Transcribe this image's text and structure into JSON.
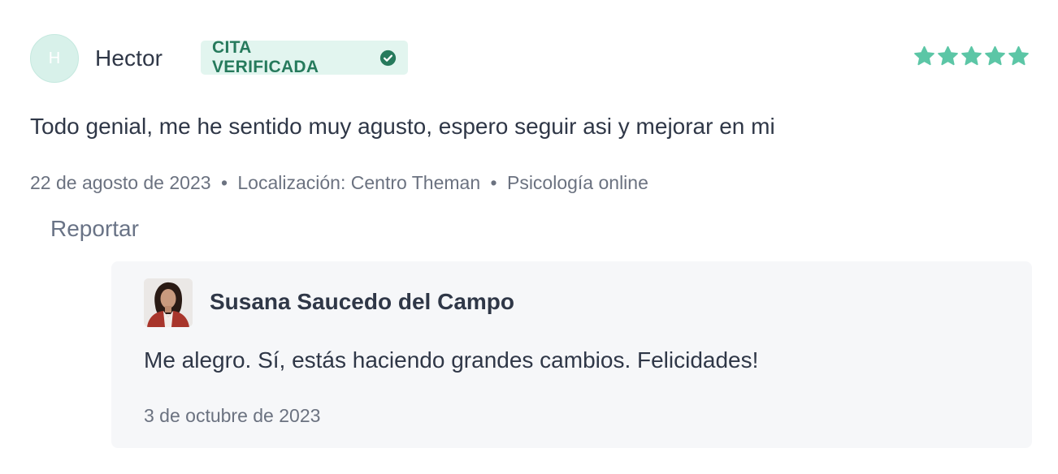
{
  "review": {
    "avatar_initial": "H",
    "author": "Hector",
    "badge_label": "CITA VERIFICADA",
    "badge_icon": "check-circle-icon",
    "rating": 5,
    "rating_max": 5,
    "star_color": "#5cc6a6",
    "text": "Todo genial, me he sentido muy agusto, espero seguir asi y mejorar en mi",
    "date": "22 de agosto de 2023",
    "location": "Localización: Centro Theman",
    "service": "Psicología online",
    "separator": "•",
    "report_label": "Reportar"
  },
  "reply": {
    "author": "Susana Saucedo del Campo",
    "text": "Me alegro. Sí, estás haciendo grandes cambios. Felicidades!",
    "date": "3 de octubre de 2023"
  },
  "colors": {
    "accent": "#5cc6a6",
    "badge_bg": "#e2f5ef",
    "badge_text": "#267a5c",
    "reply_bg": "#f6f7f9"
  }
}
